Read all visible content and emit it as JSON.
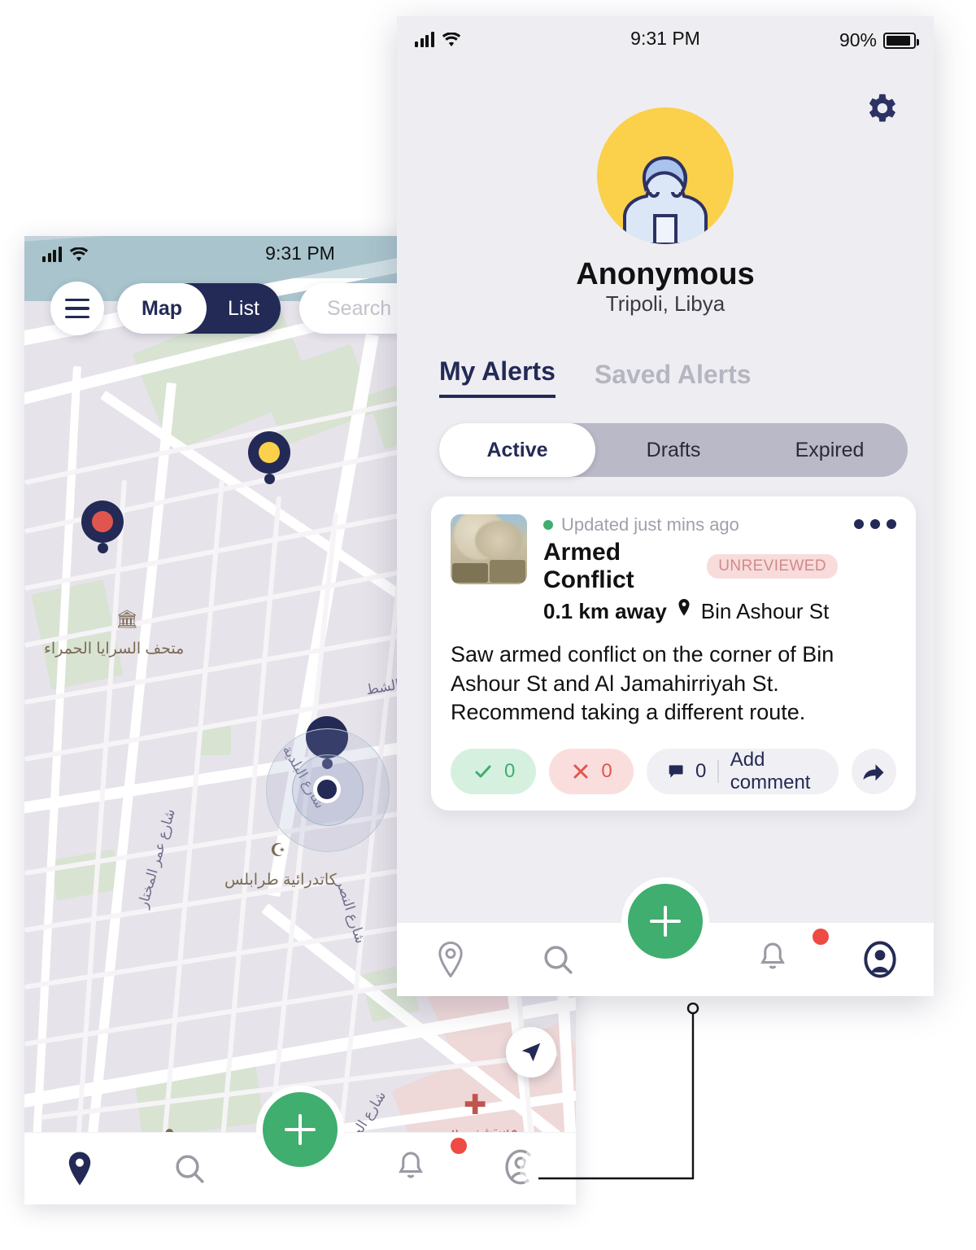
{
  "map_phone": {
    "status_bar": {
      "time": "9:31 PM",
      "signal_icon": "cellular-bars-icon",
      "wifi_icon": "wifi-icon"
    },
    "menu_icon": "hamburger-menu-icon",
    "view_toggle": {
      "options": [
        "Map",
        "List"
      ],
      "selected": "Map"
    },
    "search": {
      "placeholder": "Search lo"
    },
    "locate_icon": "locate-arrow-icon",
    "labels": {
      "museum": "متحف السرايا الحمراء",
      "cathedral": "كاتدرائية طرابلس",
      "shat": "الشط",
      "baladiya": "شارع البلدية",
      "nasr": "شارع النصر",
      "jumhuriya": "شارع الجمهورية",
      "omar": "شارع عمر المختار",
      "hospital": "مستشفى الجراحة"
    },
    "markers": [
      {
        "name": "alert-marker-yellow",
        "color": "#fbd04a"
      },
      {
        "name": "alert-marker-red",
        "color": "#e0564e"
      },
      {
        "name": "alert-marker-navy",
        "color": "#242a56"
      }
    ],
    "nav": [
      {
        "label": "map-tab",
        "icon": "location-pin-icon",
        "active": true
      },
      {
        "label": "search-tab",
        "icon": "search-icon",
        "active": false
      },
      {
        "label": "create-alert",
        "icon": "plus-icon",
        "active": false
      },
      {
        "label": "notifications-tab",
        "icon": "bell-icon",
        "active": false,
        "badge": true
      },
      {
        "label": "profile-tab",
        "icon": "profile-icon",
        "active": false
      }
    ]
  },
  "profile_phone": {
    "status_bar": {
      "time": "9:31 PM",
      "battery": "90%",
      "signal_icon": "cellular-bars-icon",
      "wifi_icon": "wifi-icon"
    },
    "settings_icon": "gear-icon",
    "avatar_icon": "anonymous-avatar-icon",
    "user": {
      "name": "Anonymous",
      "location": "Tripoli, Libya"
    },
    "tabs": [
      {
        "label": "My Alerts",
        "active": true
      },
      {
        "label": "Saved Alerts",
        "active": false
      }
    ],
    "segment": {
      "options": [
        "Active",
        "Drafts",
        "Expired"
      ],
      "selected": "Active"
    },
    "alert_card": {
      "updated": "Updated just mins ago",
      "title": "Armed Conflict",
      "badge": "UNREVIEWED",
      "distance": "0.1 km away",
      "street": "Bin Ashour St",
      "body": "Saw armed conflict on the corner of Bin Ashour St and Al Jamahirriyah St. Recommend taking a different route.",
      "upvotes": "0",
      "downvotes": "0",
      "comment_count": "0",
      "comment_label": "Add comment",
      "menu_icon": "more-options-icon",
      "share_icon": "share-arrow-icon",
      "thumbnail_icon": "conflict-photo-thumbnail"
    },
    "nav": [
      {
        "label": "map-tab",
        "icon": "location-pin-icon",
        "active": false
      },
      {
        "label": "search-tab",
        "icon": "search-icon",
        "active": false
      },
      {
        "label": "create-alert",
        "icon": "plus-icon",
        "active": false
      },
      {
        "label": "notifications-tab",
        "icon": "bell-icon",
        "active": false,
        "badge": true
      },
      {
        "label": "profile-tab",
        "icon": "profile-icon",
        "active": true
      }
    ]
  },
  "colors": {
    "navy": "#242a56",
    "green": "#3fae6e",
    "red": "#e0564e",
    "yellow": "#fbd04a",
    "badge_bg": "#f8dcdc",
    "badge_text": "#d08a8a",
    "bg": "#eeeef2"
  }
}
